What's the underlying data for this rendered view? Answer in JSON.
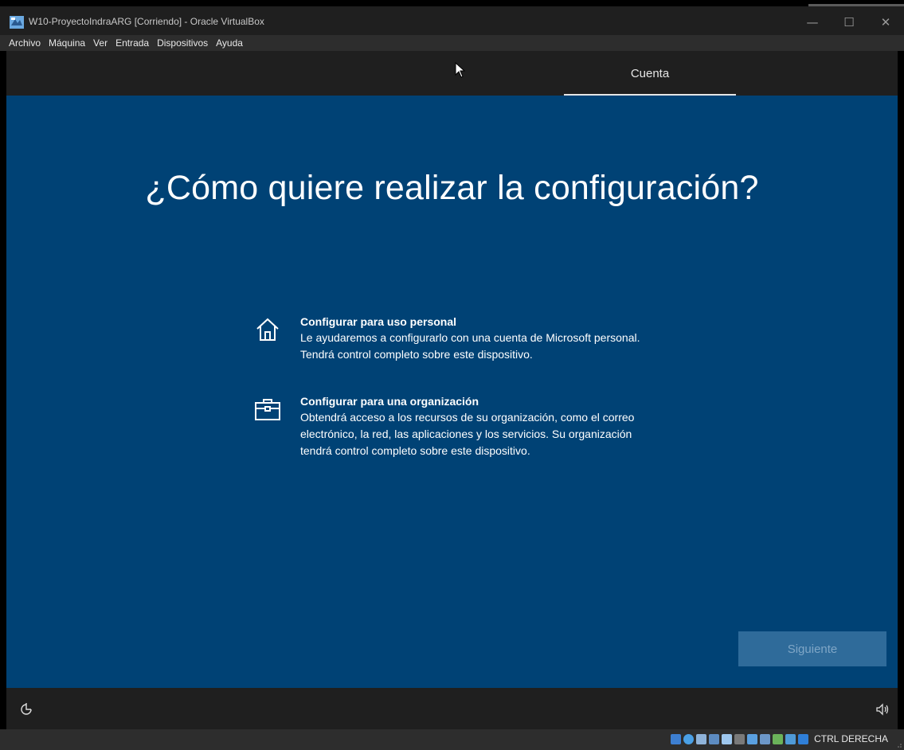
{
  "window": {
    "title": "W10-ProyectoIndraARG [Corriendo] - Oracle VirtualBox",
    "controls": [
      "minimize-icon",
      "maximize-icon",
      "close-icon"
    ]
  },
  "menu": {
    "items": [
      "Archivo",
      "Máquina",
      "Ver",
      "Entrada",
      "Dispositivos",
      "Ayuda"
    ]
  },
  "oobe": {
    "tab_label": "Cuenta",
    "heading": "¿Cómo quiere realizar la configuración?",
    "options": [
      {
        "icon": "house-icon",
        "title": "Configurar para uso personal",
        "description": "Le ayudaremos a configurarlo con una cuenta de Microsoft personal. Tendrá control completo sobre este dispositivo."
      },
      {
        "icon": "briefcase-icon",
        "title": "Configurar para una organización",
        "description": "Obtendrá acceso a los recursos de su organización, como el correo electrónico, la red, las aplicaciones y los servicios. Su organización tendrá control completo sobre este dispositivo."
      }
    ],
    "next_button": "Siguiente",
    "colors": {
      "background": "#004275",
      "button": "#2f6b9a",
      "header": "#1f1f1f"
    }
  },
  "statusbar": {
    "host_key": "CTRL DERECHA",
    "tray_icons": [
      "hard-disk-icon",
      "optical-drive-icon",
      "audio-icon",
      "network-icon",
      "usb-icon",
      "shared-folder-icon",
      "display-icon",
      "recording-icon",
      "cpu-icon",
      "mouse-integration-icon",
      "keyboard-icon"
    ]
  }
}
